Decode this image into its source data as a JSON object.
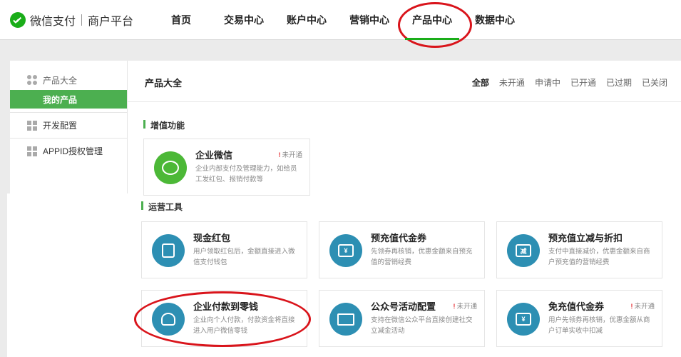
{
  "header": {
    "brand": "微信支付",
    "subtitle": "商户平台",
    "nav": [
      {
        "label": "首页",
        "active": false
      },
      {
        "label": "交易中心",
        "active": false
      },
      {
        "label": "账户中心",
        "active": false
      },
      {
        "label": "营销中心",
        "active": false
      },
      {
        "label": "产品中心",
        "active": true
      },
      {
        "label": "数据中心",
        "active": false
      }
    ],
    "accent_color": "#1aad19",
    "annotation_color": "#d9141b"
  },
  "sidebar": {
    "group_label": "产品大全",
    "group_sub": "我的产品",
    "items": [
      {
        "label": "开发配置",
        "icon": "grid-icon"
      },
      {
        "label": "APPID授权管理",
        "icon": "grid-icon"
      }
    ]
  },
  "panel": {
    "title": "产品大全",
    "filters": [
      "全部",
      "未开通",
      "申请中",
      "已开通",
      "已过期",
      "已关闭"
    ],
    "active_filter": "全部"
  },
  "sections": [
    {
      "title": "增值功能",
      "cards": [
        {
          "name": "企业微信",
          "desc": "企业内部支付及管理能力，如给员工发红包、报销付款等",
          "status": "未开通",
          "icon": "chat-bubble-icon"
        }
      ]
    },
    {
      "title": "运营工具",
      "cards": [
        {
          "name": "现金红包",
          "desc": "用户领取红包后，金额直接进入微信支付钱包",
          "status": "",
          "icon": "red-packet-icon"
        },
        {
          "name": "预充值代金券",
          "desc": "先领券再核销，优惠金额来自预充值的营销经费",
          "status": "",
          "icon": "coupon-icon",
          "glyph": "¥"
        },
        {
          "name": "预充值立减与折扣",
          "desc": "支付中直接减价，优惠金额来自商户预充值的营销经费",
          "status": "",
          "icon": "discount-icon",
          "glyph": "减"
        },
        {
          "name": "企业付款到零钱",
          "desc": "企业向个人付款，付款资金将直接进入用户微信零钱",
          "status": "",
          "icon": "users-pay-icon"
        },
        {
          "name": "公众号活动配置",
          "desc": "支持在微信公众平台直接创建社交立减金活动",
          "status": "未开通",
          "icon": "monitor-icon"
        },
        {
          "name": "免充值代金券",
          "desc": "用户先领券再核销，优惠金额从商户订单实收中扣减",
          "status": "未开通",
          "icon": "coupon-icon",
          "glyph": "¥"
        }
      ]
    }
  ]
}
